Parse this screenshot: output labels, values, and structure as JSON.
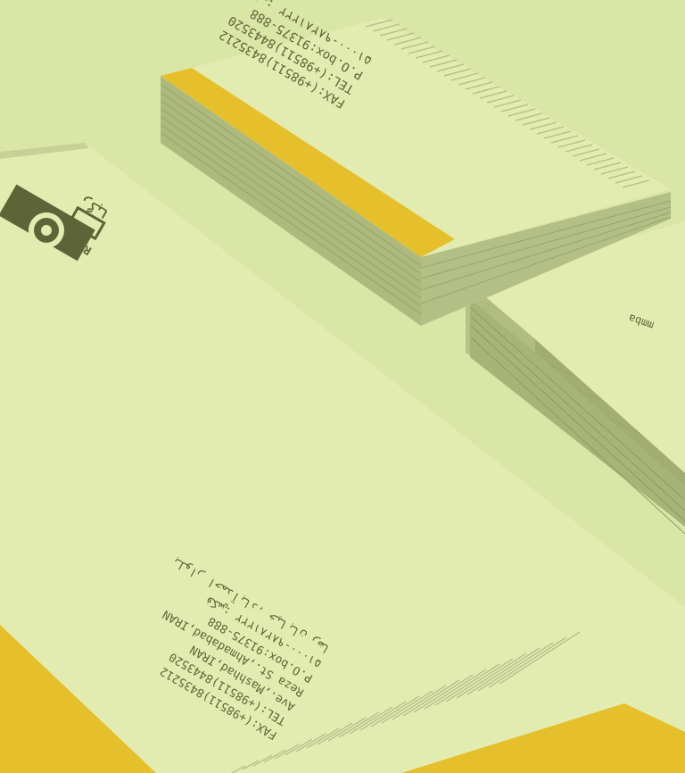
{
  "scene": {
    "colors": {
      "background": "#d9e6a6",
      "paper": "#e3ecb0",
      "accent": "#e6c02c",
      "ink": "#5d6437",
      "stripe": "#b9c28d"
    },
    "card_stack_top": {
      "lines": [
        "۵۱۰۰۰-۹۸۲۸۱۲۲۲ :فکس",
        "P.O.box:91375-888",
        "TEL:(+98511)8443520",
        "FAX:(+98511)8435212"
      ]
    },
    "card_stack_right": {
      "partial_text": "mmba"
    },
    "envelope": {
      "logo_text": "RGBA",
      "logo_farsi": "رگبا",
      "address_lines": [
        "بلوار احمدآباد، خیابان رضا",
        "۵۱۰۰۰-۹۸۲۸۱۲۲۲ :فکس",
        "P.O.box:91375-888",
        "Reza St.,Ahmadabad,IRAN",
        "Ave.,Mashhad,IRAN",
        "TEL:(+98511)8443520",
        "FAX:(+98511)8435212"
      ]
    }
  }
}
